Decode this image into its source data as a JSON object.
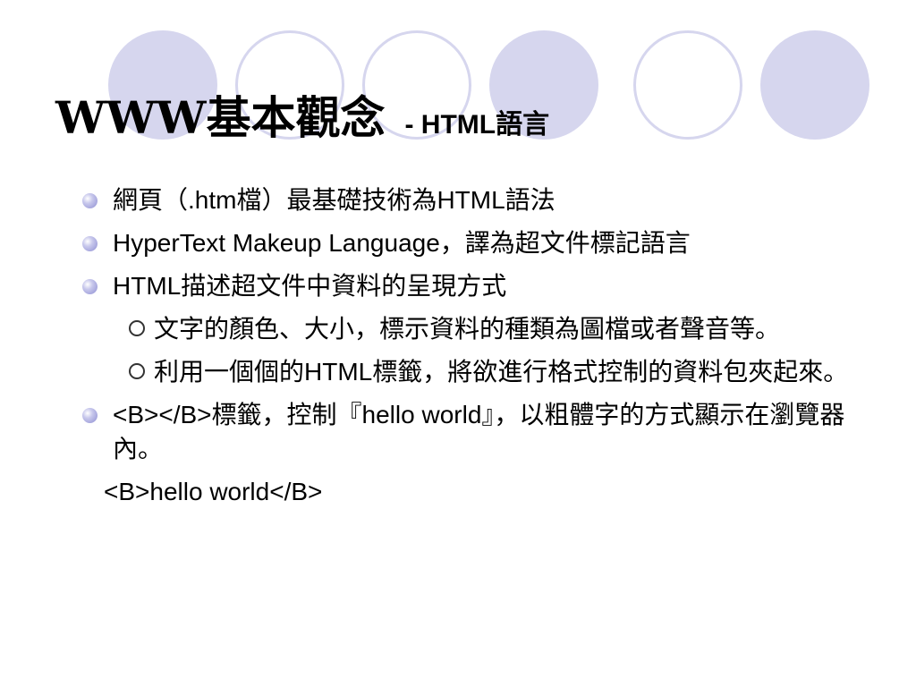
{
  "title": {
    "main": "WWW基本觀念",
    "sub": "- HTML語言"
  },
  "decor": {
    "circle_fill": "#d6d6ee",
    "bullet_color": "#9999dd"
  },
  "bullets": [
    {
      "level": 1,
      "text": "網頁（.htm檔）最基礎技術為HTML語法"
    },
    {
      "level": 1,
      "text": "HyperText Makeup Language，譯為超文件標記語言"
    },
    {
      "level": 1,
      "text": "HTML描述超文件中資料的呈現方式"
    },
    {
      "level": 2,
      "text": "文字的顏色、大小，標示資料的種類為圖檔或者聲音等。"
    },
    {
      "level": 2,
      "text": "利用一個個的HTML標籤，將欲進行格式控制的資料包夾起來。"
    },
    {
      "level": 1,
      "text": "<B></B>標籤，控制『hello world』，以粗體字的方式顯示在瀏覽器內。"
    }
  ],
  "code_line": "<B>hello world</B>"
}
